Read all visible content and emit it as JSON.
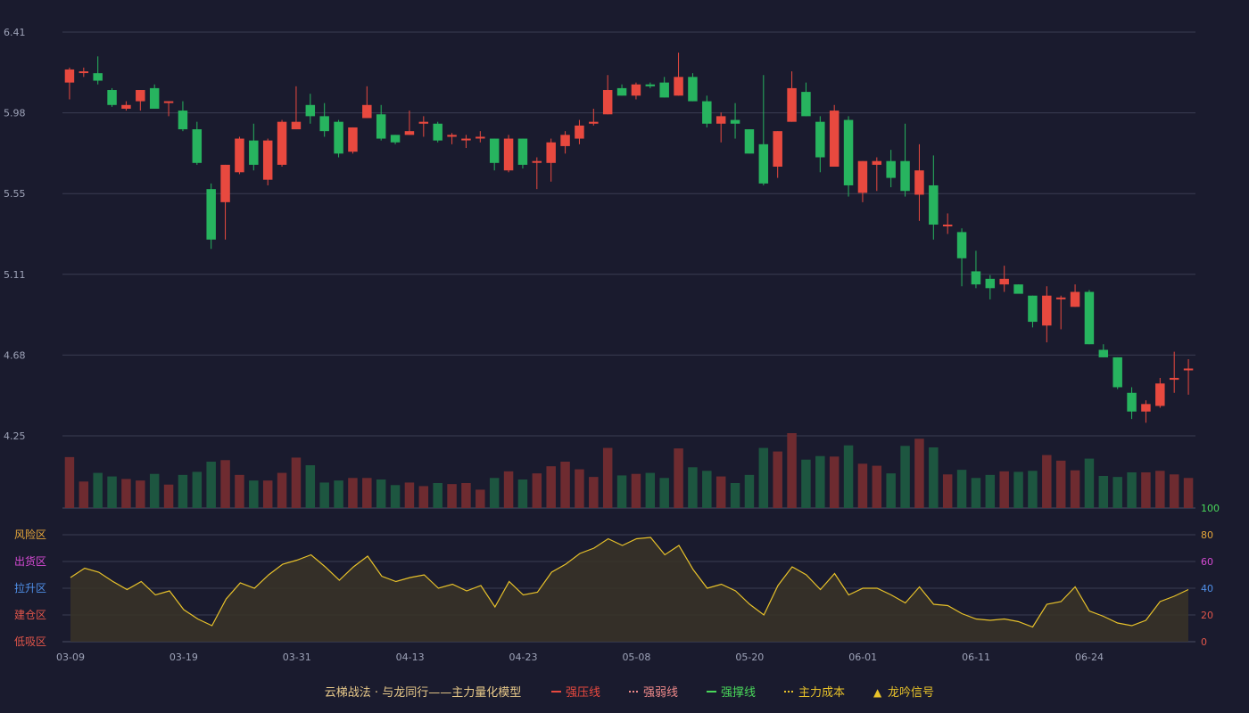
{
  "colors": {
    "background": "#1a1b2e",
    "up": "#e8493f",
    "down": "#27b45f",
    "volume_up": "#6e2b30",
    "volume_down": "#1d5640",
    "osc_line": "#e8c22a",
    "osc_fill": "#3a3327",
    "grid": "#3a3c52"
  },
  "chart_data": [
    {
      "type": "candlestick",
      "price_ticks": [
        "6.41",
        "5.98",
        "5.55",
        "5.11",
        "4.68",
        "4.25"
      ],
      "ylim": [
        4.25,
        6.41
      ],
      "x_ticks": [
        {
          "index": 0,
          "label": "03-09"
        },
        {
          "index": 8,
          "label": "03-19"
        },
        {
          "index": 16,
          "label": "03-31"
        },
        {
          "index": 24,
          "label": "04-13"
        },
        {
          "index": 32,
          "label": "04-23"
        },
        {
          "index": 40,
          "label": "05-08"
        },
        {
          "index": 48,
          "label": "05-20"
        },
        {
          "index": 56,
          "label": "06-01"
        },
        {
          "index": 64,
          "label": "06-11"
        },
        {
          "index": 72,
          "label": "06-24"
        }
      ],
      "candles": [
        [
          6.14,
          6.21,
          6.22,
          6.05
        ],
        [
          6.2,
          6.2,
          6.22,
          6.17
        ],
        [
          6.19,
          6.15,
          6.28,
          6.13
        ],
        [
          6.1,
          6.02,
          6.11,
          6.01
        ],
        [
          6.0,
          6.02,
          6.04,
          5.99
        ],
        [
          6.04,
          6.1,
          6.1,
          5.99
        ],
        [
          6.11,
          6.0,
          6.13,
          6.0
        ],
        [
          6.04,
          6.04,
          6.04,
          5.96
        ],
        [
          5.99,
          5.89,
          6.04,
          5.88
        ],
        [
          5.89,
          5.71,
          5.93,
          5.7
        ],
        [
          5.57,
          5.3,
          5.6,
          5.25
        ],
        [
          5.5,
          5.7,
          5.7,
          5.3
        ],
        [
          5.66,
          5.84,
          5.85,
          5.65
        ],
        [
          5.83,
          5.7,
          5.92,
          5.67
        ],
        [
          5.62,
          5.83,
          5.84,
          5.59
        ],
        [
          5.7,
          5.93,
          5.94,
          5.69
        ],
        [
          5.89,
          5.93,
          6.12,
          5.89
        ],
        [
          6.02,
          5.96,
          6.08,
          5.92
        ],
        [
          5.96,
          5.88,
          6.03,
          5.85
        ],
        [
          5.93,
          5.76,
          5.94,
          5.74
        ],
        [
          5.77,
          5.9,
          5.9,
          5.76
        ],
        [
          5.95,
          6.02,
          6.12,
          5.95
        ],
        [
          5.97,
          5.84,
          6.02,
          5.83
        ],
        [
          5.86,
          5.82,
          5.86,
          5.81
        ],
        [
          5.86,
          5.88,
          5.99,
          5.86
        ],
        [
          5.92,
          5.93,
          5.96,
          5.85
        ],
        [
          5.92,
          5.83,
          5.93,
          5.82
        ],
        [
          5.85,
          5.86,
          5.87,
          5.81
        ],
        [
          5.84,
          5.84,
          5.86,
          5.79
        ],
        [
          5.85,
          5.85,
          5.88,
          5.82
        ],
        [
          5.84,
          5.71,
          5.84,
          5.67
        ],
        [
          5.67,
          5.84,
          5.86,
          5.66
        ],
        [
          5.84,
          5.7,
          5.84,
          5.68
        ],
        [
          5.72,
          5.72,
          5.74,
          5.57
        ],
        [
          5.71,
          5.82,
          5.84,
          5.61
        ],
        [
          5.8,
          5.86,
          5.88,
          5.76
        ],
        [
          5.84,
          5.91,
          5.94,
          5.81
        ],
        [
          5.92,
          5.93,
          6.0,
          5.91
        ],
        [
          5.97,
          6.1,
          6.18,
          5.97
        ],
        [
          6.11,
          6.07,
          6.13,
          6.07
        ],
        [
          6.07,
          6.13,
          6.14,
          6.05
        ],
        [
          6.13,
          6.12,
          6.14,
          6.11
        ],
        [
          6.14,
          6.06,
          6.17,
          6.06
        ],
        [
          6.07,
          6.17,
          6.3,
          6.07
        ],
        [
          6.17,
          6.04,
          6.19,
          6.04
        ],
        [
          6.04,
          5.92,
          6.07,
          5.9
        ],
        [
          5.92,
          5.96,
          5.98,
          5.82
        ],
        [
          5.94,
          5.92,
          6.03,
          5.84
        ],
        [
          5.89,
          5.76,
          5.89,
          5.76
        ],
        [
          5.81,
          5.6,
          6.18,
          5.59
        ],
        [
          5.69,
          5.88,
          5.88,
          5.63
        ],
        [
          5.93,
          6.11,
          6.2,
          5.93
        ],
        [
          6.09,
          5.96,
          6.14,
          5.96
        ],
        [
          5.93,
          5.74,
          5.96,
          5.66
        ],
        [
          5.69,
          5.99,
          6.02,
          5.69
        ],
        [
          5.94,
          5.59,
          5.96,
          5.53
        ],
        [
          5.55,
          5.72,
          5.72,
          5.5
        ],
        [
          5.7,
          5.72,
          5.74,
          5.56
        ],
        [
          5.72,
          5.63,
          5.78,
          5.58
        ],
        [
          5.72,
          5.56,
          5.92,
          5.53
        ],
        [
          5.54,
          5.67,
          5.81,
          5.4
        ],
        [
          5.59,
          5.38,
          5.75,
          5.3
        ],
        [
          5.38,
          5.38,
          5.44,
          5.33
        ],
        [
          5.34,
          5.2,
          5.36,
          5.05
        ],
        [
          5.13,
          5.06,
          5.24,
          5.04
        ],
        [
          5.09,
          5.04,
          5.11,
          4.98
        ],
        [
          5.06,
          5.09,
          5.16,
          5.02
        ],
        [
          5.06,
          5.01,
          5.06,
          5.02
        ],
        [
          5.0,
          4.86,
          5.0,
          4.83
        ],
        [
          4.84,
          5.0,
          5.05,
          4.75
        ],
        [
          4.99,
          4.99,
          5.0,
          4.82
        ],
        [
          4.94,
          5.02,
          5.06,
          4.94
        ],
        [
          5.02,
          4.74,
          5.03,
          4.74
        ],
        [
          4.71,
          4.67,
          4.74,
          4.67
        ],
        [
          4.67,
          4.51,
          4.67,
          4.5
        ],
        [
          4.48,
          4.38,
          4.51,
          4.34
        ],
        [
          4.38,
          4.42,
          4.44,
          4.32
        ],
        [
          4.41,
          4.53,
          4.56,
          4.4
        ],
        [
          4.55,
          4.56,
          4.7,
          4.48
        ],
        [
          4.61,
          4.61,
          4.66,
          4.47
        ]
      ],
      "volume": [
        1.0,
        0.52,
        0.69,
        0.62,
        0.57,
        0.54,
        0.67,
        0.46,
        0.65,
        0.71,
        0.91,
        0.94,
        0.65,
        0.54,
        0.54,
        0.69,
        0.99,
        0.84,
        0.5,
        0.54,
        0.59,
        0.59,
        0.56,
        0.45,
        0.5,
        0.43,
        0.49,
        0.47,
        0.49,
        0.36,
        0.59,
        0.72,
        0.56,
        0.68,
        0.82,
        0.91,
        0.76,
        0.61,
        1.18,
        0.64,
        0.67,
        0.69,
        0.59,
        1.17,
        0.8,
        0.73,
        0.62,
        0.49,
        0.65,
        1.18,
        1.11,
        1.47,
        0.95,
        1.02,
        1.01,
        1.23,
        0.87,
        0.83,
        0.68,
        1.22,
        1.36,
        1.19,
        0.66,
        0.75,
        0.59,
        0.65,
        0.72,
        0.71,
        0.73,
        1.04,
        0.93,
        0.74,
        0.97,
        0.63,
        0.61,
        0.7,
        0.7,
        0.73,
        0.66,
        0.59
      ],
      "oscillator": {
        "levels": [
          {
            "value": 100,
            "label": "",
            "tick": "100",
            "tick_color": "#49d85a"
          },
          {
            "value": 80,
            "label": "风险区",
            "tick": "80",
            "label_color": "#e5a63a",
            "tick_color": "#e5a63a"
          },
          {
            "value": 60,
            "label": "出货区",
            "tick": "60",
            "label_color": "#d64bd4",
            "tick_color": "#d64bd4"
          },
          {
            "value": 40,
            "label": "拉升区",
            "tick": "40",
            "label_color": "#4f8fe8",
            "tick_color": "#4f8fe8"
          },
          {
            "value": 20,
            "label": "建仓区",
            "tick": "20",
            "label_color": "#e0554a",
            "tick_color": "#e0554a"
          },
          {
            "value": 0,
            "label": "低吸区",
            "tick": "0",
            "label_color": "#e0554a",
            "tick_color": "#e0554a"
          }
        ],
        "values": [
          48,
          55,
          52,
          45,
          39,
          45,
          35,
          38,
          24,
          17,
          12,
          32,
          44,
          40,
          50,
          58,
          61,
          65,
          56,
          46,
          56,
          64,
          49,
          45,
          48,
          50,
          40,
          43,
          38,
          42,
          26,
          45,
          35,
          37,
          52,
          58,
          66,
          70,
          77,
          72,
          77,
          78,
          65,
          72,
          54,
          40,
          43,
          38,
          28,
          20,
          42,
          56,
          50,
          39,
          51,
          35,
          40,
          40,
          35,
          29,
          41,
          28,
          27,
          21,
          17,
          16,
          17,
          15,
          11,
          28,
          30,
          41,
          23,
          19,
          14,
          12,
          16,
          30,
          34,
          39
        ]
      }
    }
  ],
  "legend": {
    "title": "云梯战法 · 与龙同行——主力量化模型",
    "items": [
      {
        "label": "强压线",
        "color": "#e8493f",
        "style": "solid"
      },
      {
        "label": "强弱线",
        "color": "#f08a8a",
        "style": "dotted"
      },
      {
        "label": "强撑线",
        "color": "#49d85a",
        "style": "solid"
      },
      {
        "label": "主力成本",
        "color": "#e8c22a",
        "style": "dotted"
      },
      {
        "label": "龙吟信号",
        "color": "#e8c22a",
        "style": "triangle"
      }
    ]
  }
}
